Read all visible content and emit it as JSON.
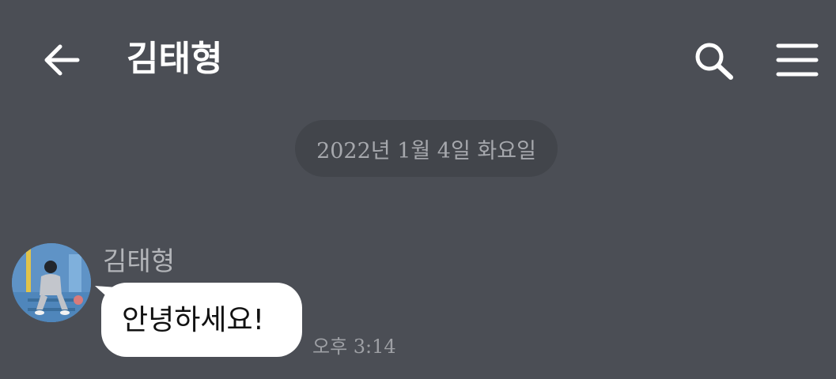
{
  "header": {
    "title": "김태형",
    "back_icon": "arrow-left-icon",
    "search_icon": "search-icon",
    "menu_icon": "hamburger-menu-icon"
  },
  "date_divider": "2022년 1월 4일 화요일",
  "message": {
    "sender": "김태형",
    "text": "안녕하세요!",
    "time": "오후 3:14"
  },
  "colors": {
    "background": "#4b4e55",
    "date_chip": "#42454b",
    "bubble": "#ffffff",
    "avatar_accent": "#5f93c6"
  }
}
